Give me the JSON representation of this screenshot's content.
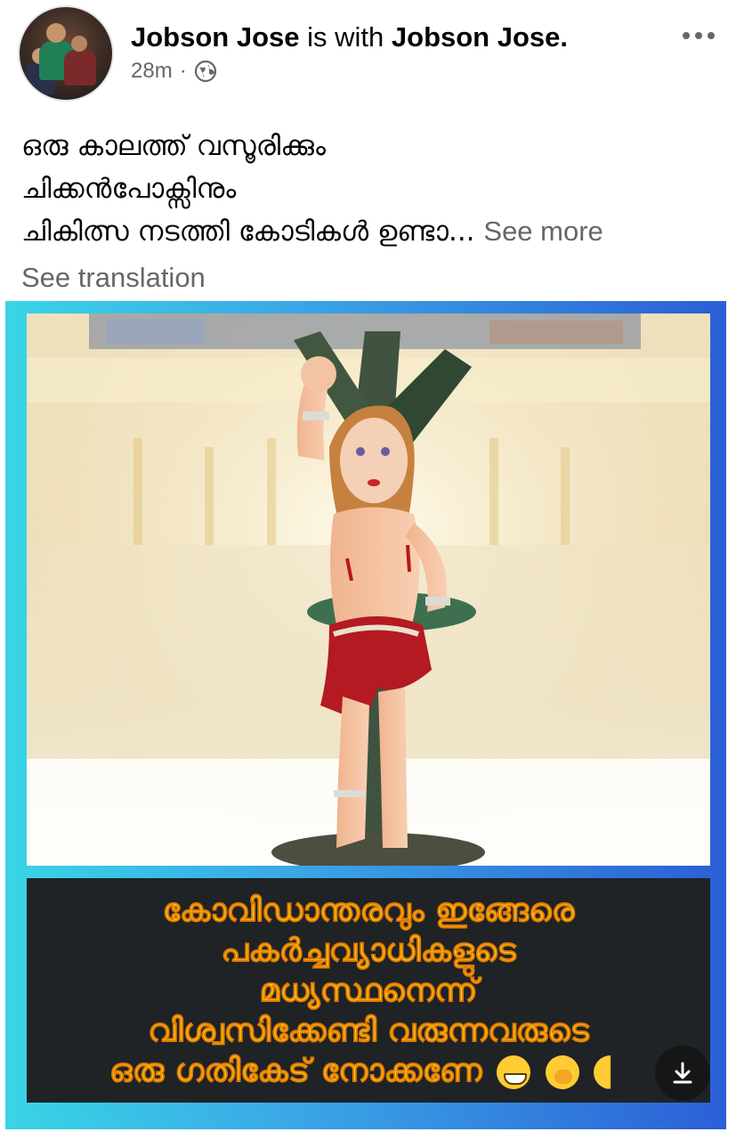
{
  "post": {
    "author": "Jobson Jose",
    "with_text": "is with",
    "tagged": "Jobson Jose.",
    "time": "28m",
    "separator": "·",
    "audience_icon": "globe-icon",
    "menu_icon": "more-options-icon"
  },
  "body": {
    "lines": [
      "ഒരു കാലത്ത് വസൂരിക്കും",
      "ചിക്കൻപോക്സിനും",
      "ചികിത്സ നടത്തി കോടികൾ ഉണ്ടാ..."
    ],
    "see_more": "See more",
    "see_translation": "See translation"
  },
  "image": {
    "caption_lines": [
      "കോവിഡാന്തരവും ഇങ്ങേരെ",
      "പകർച്ചവ്യാധികളുടെ",
      "മധ്യസ്ഥനെന്ന്",
      "വിശ്വസിക്കേണ്ടി വരുന്നവരുടെ",
      "ഒരു ഗതികേട് നോക്കണേ"
    ],
    "emojis": [
      "grinning-face-icon",
      "face-with-hand-over-mouth-icon",
      "partial-emoji-icon"
    ],
    "download_icon": "download-icon"
  },
  "colors": {
    "caption_text": "#ffd21a",
    "caption_bg": "#1f2326",
    "frame_gradient_start": "#39d5e6",
    "frame_gradient_end": "#2b5fd6",
    "meta_gray": "#65676b"
  }
}
